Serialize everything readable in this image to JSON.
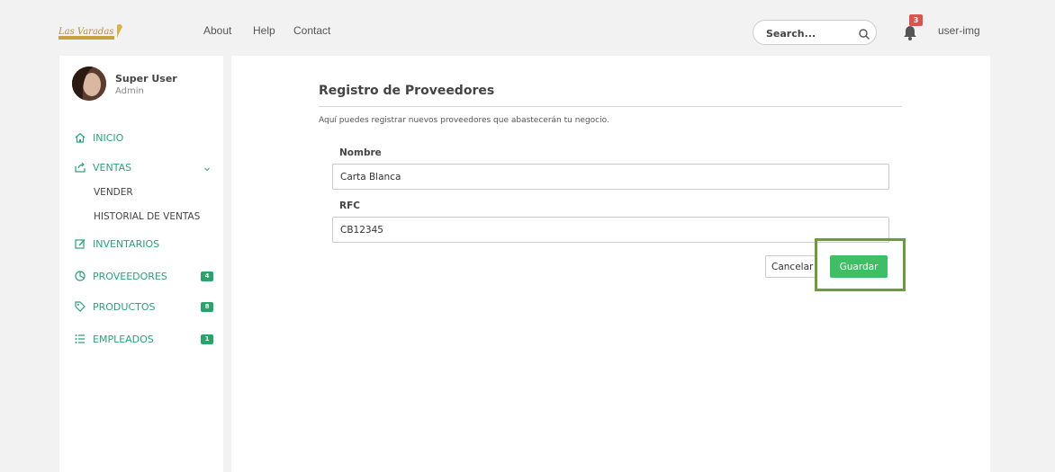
{
  "header": {
    "logo_alt": "Las Varadas",
    "nav": [
      {
        "label": "About"
      },
      {
        "label": "Help"
      },
      {
        "label": "Contact"
      }
    ],
    "search": {
      "placeholder": "Search...",
      "value": ""
    },
    "notifications": {
      "count": "3"
    },
    "user_label": "user-img"
  },
  "sidebar": {
    "user": {
      "name": "Super User",
      "role": "Admin"
    },
    "items": [
      {
        "label": "INICIO",
        "icon": "home-icon"
      },
      {
        "label": "VENTAS",
        "icon": "share-icon",
        "expanded": true,
        "children": [
          {
            "label": "VENDER"
          },
          {
            "label": "HISTORIAL DE VENTAS"
          }
        ]
      },
      {
        "label": "INVENTARIOS",
        "icon": "edit-icon"
      },
      {
        "label": "PROVEEDORES",
        "icon": "pie-chart-icon",
        "badge": "4"
      },
      {
        "label": "PRODUCTOS",
        "icon": "tag-icon",
        "badge": "8"
      },
      {
        "label": "EMPLEADOS",
        "icon": "list-icon",
        "badge": "1"
      }
    ]
  },
  "main": {
    "title": "Registro de Proveedores",
    "description": "Aquí puedes registrar nuevos proveedores que abastecerán tu negocio.",
    "fields": [
      {
        "label": "Nombre",
        "value": "Carta Blanca"
      },
      {
        "label": "RFC",
        "value": "CB12345"
      }
    ],
    "cancel_label": "Cancelar",
    "save_label": "Guardar"
  },
  "colors": {
    "accent": "#29a37a",
    "save_button": "#3fbf63",
    "badge_red": "#d9534f",
    "highlight": "#6a9e35"
  }
}
